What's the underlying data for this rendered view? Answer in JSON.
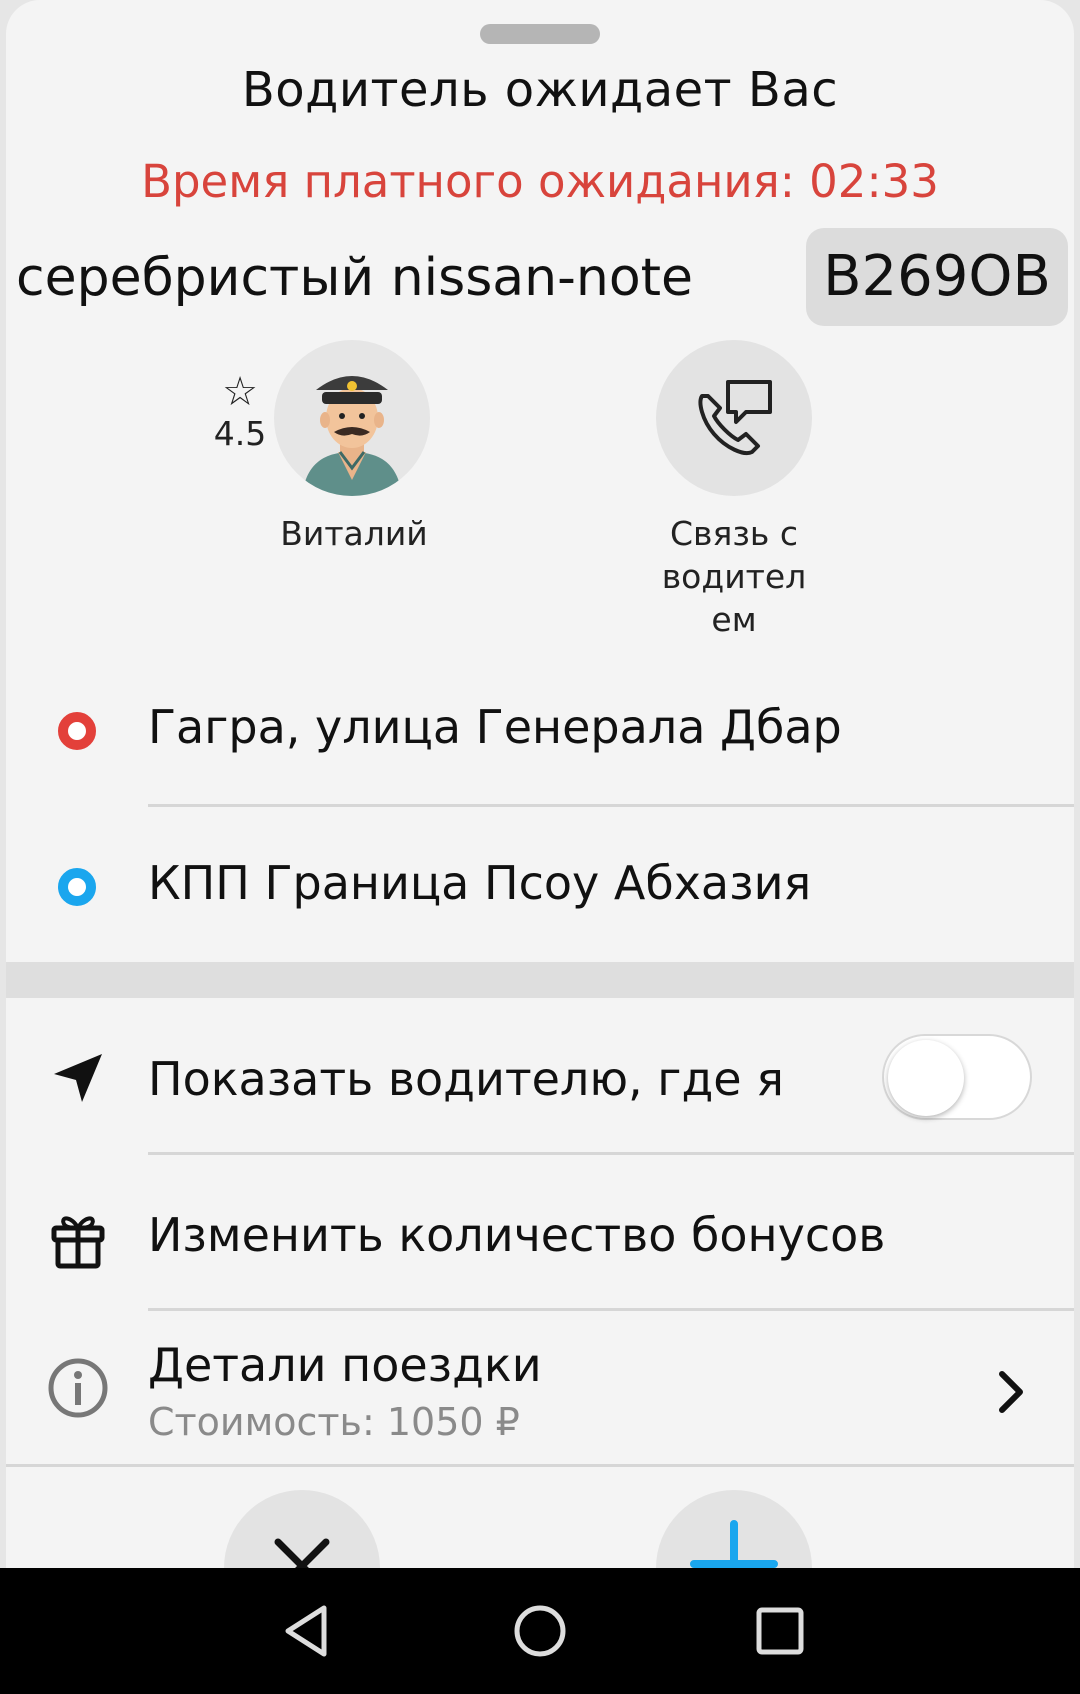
{
  "sheet": {
    "title": "Водитель ожидает Вас",
    "paid_wait": "Время платного ожидания: 02:33",
    "car": "серебристый nissan-note",
    "plate": "В269ОВ"
  },
  "driver": {
    "rating": "4.5",
    "name": "Виталий",
    "contact_label": "Связь с водителем"
  },
  "route": {
    "from": "Гагра, улица Генерала Дбар",
    "to": "КПП Граница Псоу Абхазия",
    "from_color": "#e3403a",
    "to_color": "#1aa6ee"
  },
  "options": {
    "show_location": "Показать водителю, где я",
    "show_location_on": false,
    "bonuses": "Изменить количество бонусов",
    "details_title": "Детали поездки",
    "details_cost": "Стоимость: 1050 ₽"
  },
  "icons": {
    "star": "star-icon",
    "call": "phone-chat-icon",
    "location": "navigation-arrow-icon",
    "gift": "gift-icon",
    "info": "info-icon",
    "chevron": "chevron-right-icon",
    "cancel": "close-icon",
    "add": "plus-icon"
  }
}
